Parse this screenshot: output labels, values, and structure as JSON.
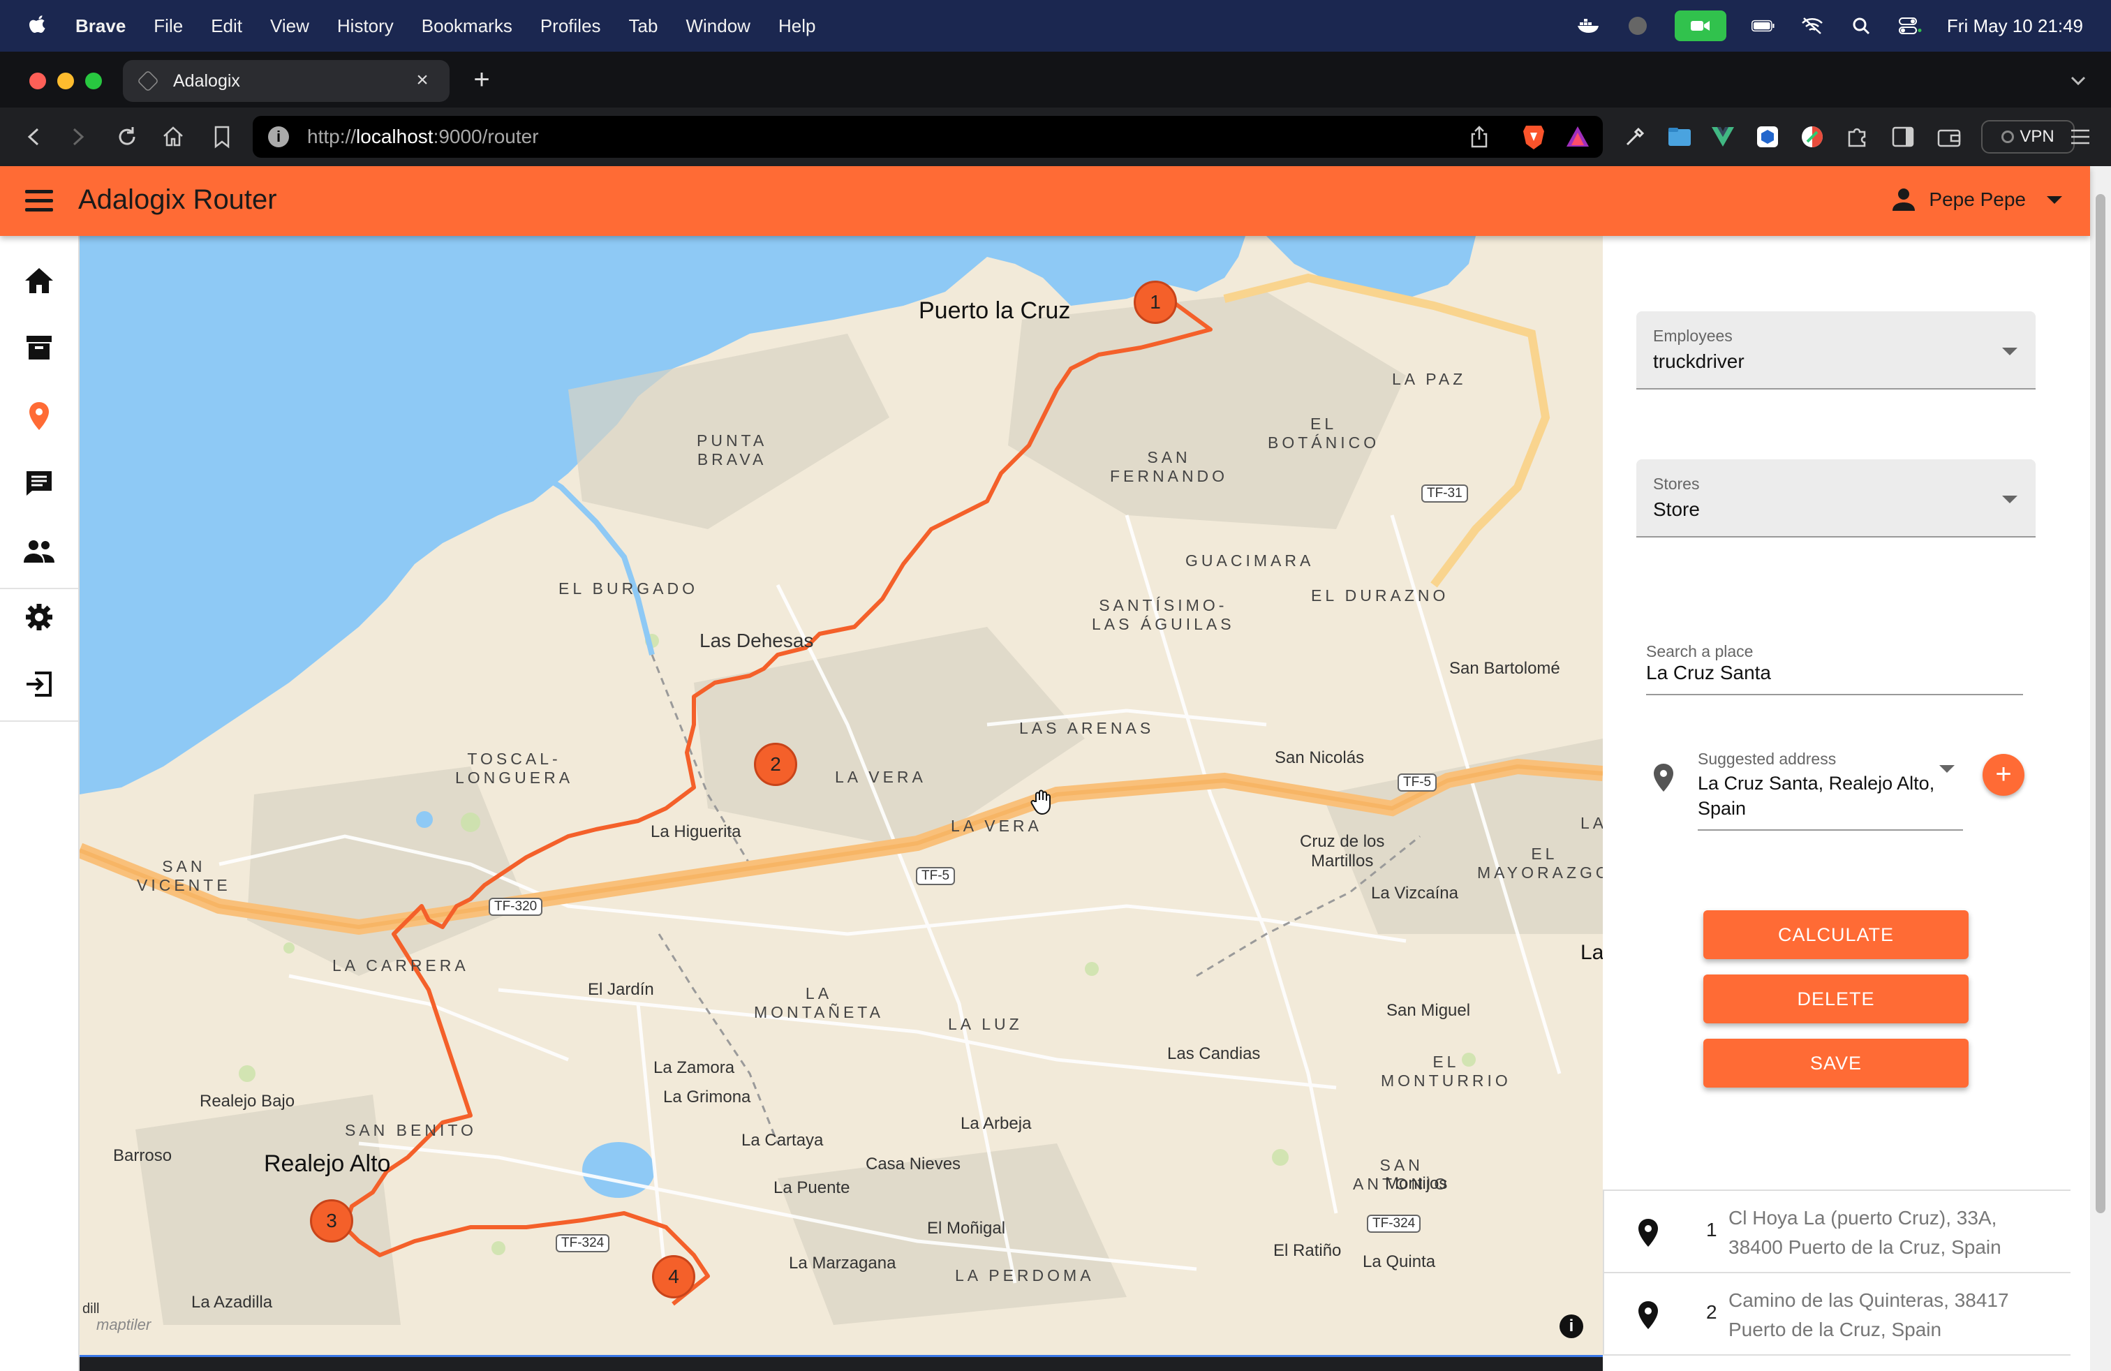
{
  "os_menubar": {
    "app": "Brave",
    "items": [
      "File",
      "Edit",
      "View",
      "History",
      "Bookmarks",
      "Profiles",
      "Tab",
      "Window",
      "Help"
    ],
    "clock": "Fri May 10  21:49"
  },
  "browser": {
    "tab_title": "Adalogix",
    "url_prefix": "http://",
    "url_host": "localhost",
    "url_rest": ":9000/router",
    "vpn_label": "VPN"
  },
  "app": {
    "title": "Adalogix Router",
    "user_name": "Pepe Pepe",
    "nav_icons": [
      "home-icon",
      "archive-icon",
      "map-pin-icon",
      "chat-icon",
      "people-icon",
      "settings-icon",
      "logout-icon"
    ]
  },
  "map": {
    "labels": {
      "puerto_la_cruz": "Puerto la Cruz",
      "punta_brava": "PUNTA\nBRAVA",
      "la_paz": "LA PAZ",
      "el_botanico": "EL\nBOTÁNICO",
      "san_fernando": "SAN\nFERNANDO",
      "guacimara": "GUACIMARA",
      "el_burgado": "EL BURGADO",
      "santisimo": "SANTÍSIMO-\nLAS ÁGUILAS",
      "el_durazno": "EL DURAZNO",
      "las_dehesas": "Las Dehesas",
      "san_bartolome": "San Bartolomé",
      "toscal": "TOSCAL-\nLONGUERA",
      "las_arenas": "LAS ARENAS",
      "la_vera_1": "LA VERA",
      "la_vera_2": "LA VERA",
      "san_nicolas": "San Nicolás",
      "la_higuerita": "La Higuerita",
      "cruz_martillos": "Cruz de los\nMartillos",
      "el_mayorazgo": "EL\nMAYORAZGO",
      "san_vicente": "SAN\nVICENTE",
      "la_vizcaina": "La Vizcaína",
      "la_carrera": "LA CARRERA",
      "el_jardin": "El Jardín",
      "la_montaneta": "LA\nMONTAÑETA",
      "la_luz": "LA LUZ",
      "san_miguel": "San Miguel",
      "la_zamora": "La Zamora",
      "la_grimona": "La Grimona",
      "las_candias": "Las Candias",
      "el_monturrio": "EL\nMONTURRIO",
      "realejo_bajo": "Realejo Bajo",
      "san_benito": "SAN BENITO",
      "la_arbeja": "La Arbeja",
      "barroso": "Barroso",
      "la_cartaya": "La Cartaya",
      "casa_nieves": "Casa Nieves",
      "realejo_alto": "Realejo Alto",
      "la_puente": "La Puente",
      "san_antonio": "SAN\nANTONIO",
      "montijos": "Montijos",
      "el_monigal": "El Moñigal",
      "el_ratino": "El Ratiño",
      "la_quinta": "La Quinta",
      "la_marzagana": "La Marzagana",
      "la_perdoma": "LA PERDOMA",
      "la_azadilla": "La Azadilla",
      "la_edge_1": "LA",
      "la_edge_2": "La",
      "dill": "dill"
    },
    "roads": {
      "tf31": "TF-31",
      "tf5a": "TF-5",
      "tf5b": "TF-5",
      "tf320": "TF-320",
      "tf324a": "TF-324",
      "tf324b": "TF-324"
    },
    "markers": [
      "1",
      "2",
      "3",
      "4"
    ],
    "attribution": "maptiler"
  },
  "panel": {
    "employees_label": "Employees",
    "employees_value": "truckdriver",
    "stores_label": "Stores",
    "stores_value": "Store",
    "search_label": "Search a place",
    "search_value": "La Cruz Santa",
    "suggest_label": "Suggested address",
    "suggest_value": "La Cruz Santa, Realejo Alto, Spain",
    "add_label": "+",
    "buttons": {
      "calculate": "CALCULATE",
      "delete": "DELETE",
      "save": "SAVE"
    },
    "stops": [
      {
        "num": "1",
        "address": "Cl Hoya La (puerto Cruz), 33A, 38400 Puerto de la Cruz, Spain"
      },
      {
        "num": "2",
        "address": "Camino de las Quinteras, 38417 Puerto de la Cruz, Spain"
      }
    ]
  },
  "colors": {
    "accent": "#ff6b35",
    "route": "#f4602a",
    "sea": "#8ec9f5",
    "land": "#f2ead9"
  }
}
